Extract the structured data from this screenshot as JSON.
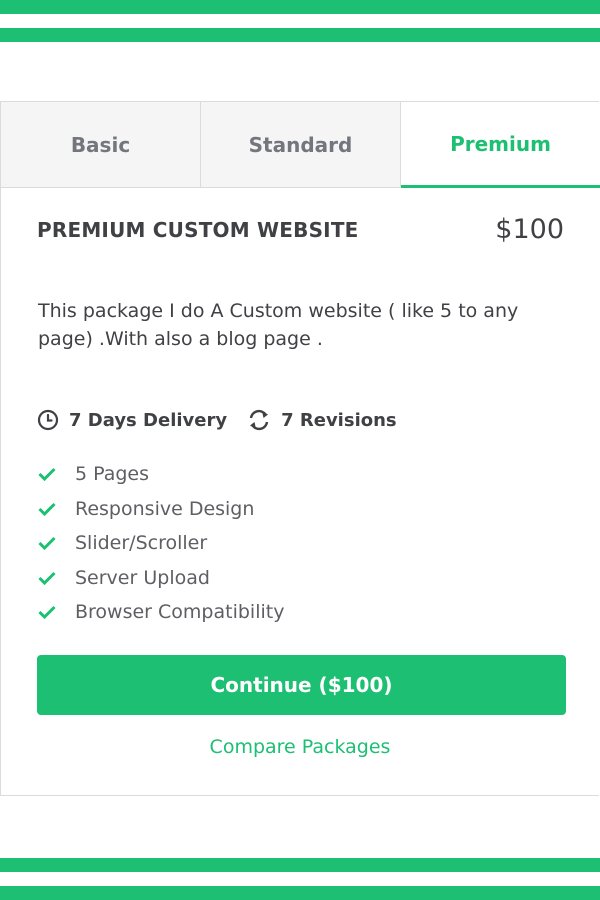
{
  "tabs": [
    {
      "label": "Basic",
      "active": false
    },
    {
      "label": "Standard",
      "active": false
    },
    {
      "label": "Premium",
      "active": true
    }
  ],
  "package": {
    "title": "PREMIUM CUSTOM WEBSITE",
    "price": "$100",
    "description": "This package I do A Custom website ( like 5 to any page) .With also a blog page .",
    "delivery": "7 Days Delivery",
    "revisions": "7 Revisions",
    "features": [
      "5 Pages",
      "Responsive Design",
      "Slider/Scroller",
      "Server Upload",
      "Browser Compatibility"
    ]
  },
  "actions": {
    "continue_label": "Continue ($100)",
    "compare_label": "Compare Packages"
  },
  "colors": {
    "accent": "#1dbf73",
    "text": "#404145",
    "muted": "#74767e",
    "border": "#dadbdd"
  },
  "icons": {
    "delivery": "clock-icon",
    "revisions": "refresh-icon",
    "feature": "check-icon"
  }
}
